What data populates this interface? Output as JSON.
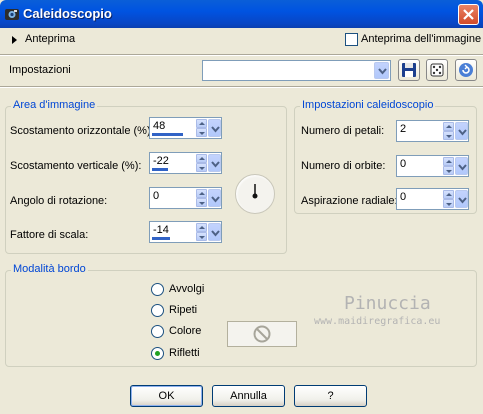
{
  "window": {
    "title": "Caleidoscopio",
    "icon": "app-icon",
    "close_icon": "close-icon"
  },
  "preview": {
    "label": "Anteprima",
    "checkbox_label": "Anteprima dell'immagine",
    "checked": false
  },
  "settings": {
    "label": "Impostazioni",
    "value": "",
    "tools": [
      "save-icon",
      "dice-icon",
      "reset-icon"
    ]
  },
  "image_area": {
    "title": "Area d'immagine",
    "fields": [
      {
        "label": "Scostamento orizzontale (%):",
        "value": "48",
        "level": 0.74
      },
      {
        "label": "Scostamento verticale (%):",
        "value": "-22",
        "level": 0.39
      },
      {
        "label": "Angolo di rotazione:",
        "value": "0",
        "level": 0.0
      },
      {
        "label": "Fattore di scala:",
        "value": "-14",
        "level": 0.43
      }
    ]
  },
  "kaleido": {
    "title": "Impostazioni caleidoscopio",
    "fields": [
      {
        "label": "Numero di petali:",
        "value": "2",
        "level": 0.0
      },
      {
        "label": "Numero di orbite:",
        "value": "0",
        "level": 0.0
      },
      {
        "label": "Aspirazione radiale:",
        "value": "0",
        "level": 0.0
      }
    ]
  },
  "border_mode": {
    "title": "Modalità bordo",
    "options": [
      "Avvolgi",
      "Ripeti",
      "Colore",
      "Rifletti"
    ],
    "selected": "Rifletti"
  },
  "watermark": {
    "name": "Pinuccia",
    "url": "www.maidiregrafica.eu"
  },
  "buttons": {
    "ok": "OK",
    "cancel": "Annulla",
    "help": "?"
  }
}
